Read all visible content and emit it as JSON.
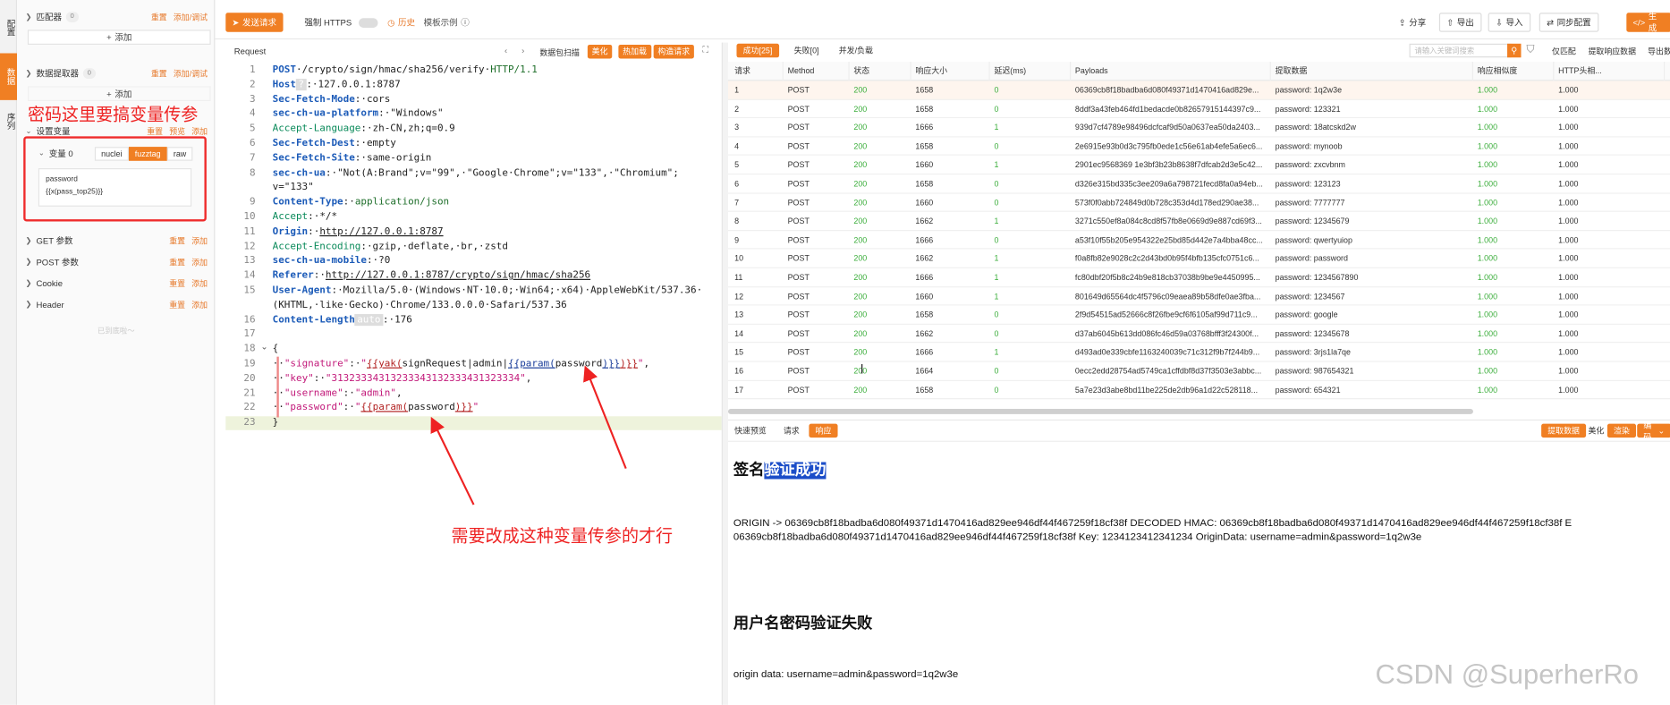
{
  "rail": {
    "tabs": [
      "配置",
      "数据",
      "序列"
    ]
  },
  "left": {
    "matchers": {
      "label": "匹配器",
      "count": "0",
      "reset": "重置",
      "add": "添加/调试"
    },
    "add_label": "添加",
    "extractors": {
      "label": "数据提取器",
      "count": "0",
      "reset": "重置",
      "add": "添加/调试"
    },
    "add_label2": "添加",
    "annotation": "密码这里要搞变量传参",
    "setvars": {
      "label": "设置变量",
      "reset": "重置",
      "preview": "预览",
      "add": "添加"
    },
    "var0": {
      "label": "变量 0",
      "modes": [
        "nuclei",
        "fuzztag",
        "raw"
      ],
      "active_mode": "fuzztag",
      "name": "password",
      "value": "{{x(pass_top25)}}"
    },
    "get": {
      "label": "GET 参数",
      "reset": "重置",
      "add": "添加"
    },
    "post": {
      "label": "POST 参数",
      "reset": "重置",
      "add": "添加"
    },
    "cookie": {
      "label": "Cookie",
      "reset": "重置",
      "add": "添加"
    },
    "header": {
      "label": "Header",
      "reset": "重置",
      "add": "添加"
    },
    "bottom": "已到底啦～"
  },
  "top": {
    "send": "发送请求",
    "force_https": "强制 HTTPS",
    "history": "历史",
    "example": "模板示例",
    "share": "分享",
    "export": "导出",
    "import": "导入",
    "sync": "同步配置",
    "gen": "生成"
  },
  "request": {
    "title": "Request",
    "extract": "数据包扫描",
    "beautify": "美化",
    "hot": "热加载",
    "build": "构造请求",
    "lines": [
      {
        "n": "1",
        "html": "<span class='k'>POST</span>·/crypto/sign/hmac/sha256/verify·<span class='g'>HTTP/1.1</span>"
      },
      {
        "n": "2",
        "html": "<span class='k'>Host</span><span class='auto'>?</span>:·127.0.0.1:8787"
      },
      {
        "n": "3",
        "html": "<span class='k'>Sec-Fetch-Mode</span>:·cors"
      },
      {
        "n": "4",
        "html": "<span class='k'>sec-ch-ua-platform</span>:·\"Windows\""
      },
      {
        "n": "5",
        "html": "<span class='s'>Accept-Language</span>:·zh-CN,zh;q=0.9"
      },
      {
        "n": "6",
        "html": "<span class='k'>Sec-Fetch-Dest</span>:·empty"
      },
      {
        "n": "7",
        "html": "<span class='k'>Sec-Fetch-Site</span>:·same-origin"
      },
      {
        "n": "8",
        "html": "<span class='k'>sec-ch-ua</span>:·\"Not(A:Brand\";v=\"99\",·\"Google·Chrome\";v=\"133\",·\"Chromium\";"
      },
      {
        "n": "",
        "html": "v=\"133\""
      },
      {
        "n": "9",
        "html": "<span class='k'>Content-Type</span>:·<span class='g'>application/json</span>"
      },
      {
        "n": "10",
        "html": "<span class='s'>Accept</span>:·*/*"
      },
      {
        "n": "11",
        "html": "<span class='k'>Origin</span>:·<span class='url'>http://127.0.0.1:8787</span>"
      },
      {
        "n": "12",
        "html": "<span class='s'>Accept-Encoding</span>:·gzip,·deflate,·br,·zstd"
      },
      {
        "n": "13",
        "html": "<span class='k'>sec-ch-ua-mobile</span>:·?0"
      },
      {
        "n": "14",
        "html": "<span class='k'>Referer</span>:·<span class='url'>http://127.0.0.1:8787/crypto/sign/hmac/sha256</span>"
      },
      {
        "n": "15",
        "html": "<span class='k'>User-Agent</span>:·Mozilla/5.0·(Windows·NT·10.0;·Win64;·x64)·AppleWebKit/537.36·"
      },
      {
        "n": "",
        "html": "(KHTML,·like·Gecko)·Chrome/133.0.0.0·Safari/537.36"
      },
      {
        "n": "16",
        "html": "<span class='k'>Content-Length</span><span class='auto'>auto</span>:·176"
      },
      {
        "n": "17",
        "html": ""
      },
      {
        "n": "18",
        "html": "{"
      },
      {
        "n": "19",
        "html": "··<span class='sig'>\"signature\"</span>:·<span class='sig'>\"</span><span class='tpl'>{{yak(</span>signRequest|admin|<span class='tpl2'>{{param(</span>password<span class='tpl2'>)}}</span><span class='tpl'>)}}</span><span class='sig'>\"</span>,"
      },
      {
        "n": "20",
        "html": "··<span class='sig'>\"key\"</span>:·<span class='sig'>\"31323334313233343132333431323334\"</span>,"
      },
      {
        "n": "21",
        "html": "··<span class='sig'>\"username\"</span>:·<span class='sig'>\"admin\"</span>,"
      },
      {
        "n": "22",
        "html": "··<span class='sig'>\"password\"</span>:·<span class='sig'>\"</span><span class='tpl'>{{param(</span>password<span class='tpl'>)}}</span><span class='sig'>\"</span>"
      },
      {
        "n": "23",
        "html": "}"
      }
    ],
    "annotation": "需要改成这种变量传参的才行"
  },
  "results": {
    "tabs": [
      "成功[25]",
      "失败[0]",
      "并发/负载"
    ],
    "search_placeholder": "请输入关键词搜索",
    "actions": [
      "仅匹配",
      "提取响应数据",
      "导出数"
    ],
    "columns": [
      "请求",
      "Method",
      "状态",
      "响应大小",
      "延迟(ms)",
      "Payloads",
      "提取数据",
      "响应相似度",
      "HTTP头相..."
    ],
    "rows": [
      [
        "1",
        "POST",
        "200",
        "1658",
        "0",
        "06369cb8f18badba6d080f49371d1470416ad829e...",
        "password: 1q2w3e",
        "1.000",
        "1.000"
      ],
      [
        "2",
        "POST",
        "200",
        "1658",
        "0",
        "8ddf3a43feb464fd1bedacde0b82657915144397c9...",
        "password: 123321",
        "1.000",
        "1.000"
      ],
      [
        "3",
        "POST",
        "200",
        "1666",
        "1",
        "939d7cf4789e98496dcfcaf9d50a0637ea50da2403...",
        "password: 18atcskd2w",
        "1.000",
        "1.000"
      ],
      [
        "4",
        "POST",
        "200",
        "1658",
        "0",
        "2e6915e93b0d3c795fb0ede1c56e61ab4efe5a6ec6...",
        "password: mynoob",
        "1.000",
        "1.000"
      ],
      [
        "5",
        "POST",
        "200",
        "1660",
        "1",
        "2901ec9568369 1e3bf3b23b8638f7dfcab2d3e5c42...",
        "password: zxcvbnm",
        "1.000",
        "1.000"
      ],
      [
        "6",
        "POST",
        "200",
        "1658",
        "0",
        "d326e315bd335c3ee209a6a798721fecd8fa0a94eb...",
        "password: 123123",
        "1.000",
        "1.000"
      ],
      [
        "7",
        "POST",
        "200",
        "1660",
        "0",
        "573f0f0abb724849d0b728c353d4d178ed290ae38...",
        "password: 7777777",
        "1.000",
        "1.000"
      ],
      [
        "8",
        "POST",
        "200",
        "1662",
        "1",
        "3271c550ef8a084c8cd8f57fb8e0669d9e887cd69f3...",
        "password: 12345679",
        "1.000",
        "1.000"
      ],
      [
        "9",
        "POST",
        "200",
        "1666",
        "0",
        "a53f10f55b205e954322e25bd85d442e7a4bba48cc...",
        "password: qwertyuiop",
        "1.000",
        "1.000"
      ],
      [
        "10",
        "POST",
        "200",
        "1662",
        "1",
        "f0a8fb82e9028c2c2d43bd0b95f4bfb135cfc0751c6...",
        "password: password",
        "1.000",
        "1.000"
      ],
      [
        "11",
        "POST",
        "200",
        "1666",
        "1",
        "fc80dbf20f5b8c24b9e818cb37038b9be9e4450995...",
        "password: 1234567890",
        "1.000",
        "1.000"
      ],
      [
        "12",
        "POST",
        "200",
        "1660",
        "1",
        "801649d65564dc4f5796c09eaea89b58dfe0ae3fba...",
        "password: 1234567",
        "1.000",
        "1.000"
      ],
      [
        "13",
        "POST",
        "200",
        "1658",
        "0",
        "2f9d54515ad52666c8f26fbe9cf6f6105af99d711c9...",
        "password: google",
        "1.000",
        "1.000"
      ],
      [
        "14",
        "POST",
        "200",
        "1662",
        "0",
        "d37ab6045b613dd086fc46d59a03768bfff3f24300f...",
        "password: 12345678",
        "1.000",
        "1.000"
      ],
      [
        "15",
        "POST",
        "200",
        "1666",
        "1",
        "d493ad0e339cbfe1163240039c71c312f9b7f244b9...",
        "password: 3rjs1la7qe",
        "1.000",
        "1.000"
      ],
      [
        "16",
        "POST",
        "200",
        "1664",
        "0",
        "0ecc2edd28754ad5749ca1cffdbf8d37f3503e3abbc...",
        "password: 987654321",
        "1.000",
        "1.000"
      ],
      [
        "17",
        "POST",
        "200",
        "1658",
        "0",
        "5a7e23d3abe8bd11be225de2db96a1d22c528118...",
        "password: 654321",
        "1.000",
        "1.000"
      ]
    ]
  },
  "response": {
    "tabs": [
      "快速预览",
      "请求",
      "响应"
    ],
    "right": [
      "提取数据",
      "美化",
      "渲染",
      "编码"
    ],
    "h1_a": "签名",
    "h1_b": "验证成功",
    "p1": "ORIGIN -> 06369cb8f18badba6d080f49371d1470416ad829ee946df44f467259f18cf38f DECODED HMAC: 06369cb8f18badba6d080f49371d1470416ad829ee946df44f467259f18cf38f E",
    "p2": "06369cb8f18badba6d080f49371d1470416ad829ee946df44f467259f18cf38f Key: 1234123412341234 OriginData: username=admin&password=1q2w3e",
    "h2": "用户名密码验证失败",
    "p3": "origin data: username=admin&password=1q2w3e",
    "watermark": "CSDN @SuperherRo"
  },
  "colors": {
    "accent": "#f07f23",
    "annotation": "#ee2222",
    "success": "#3cae3c"
  }
}
